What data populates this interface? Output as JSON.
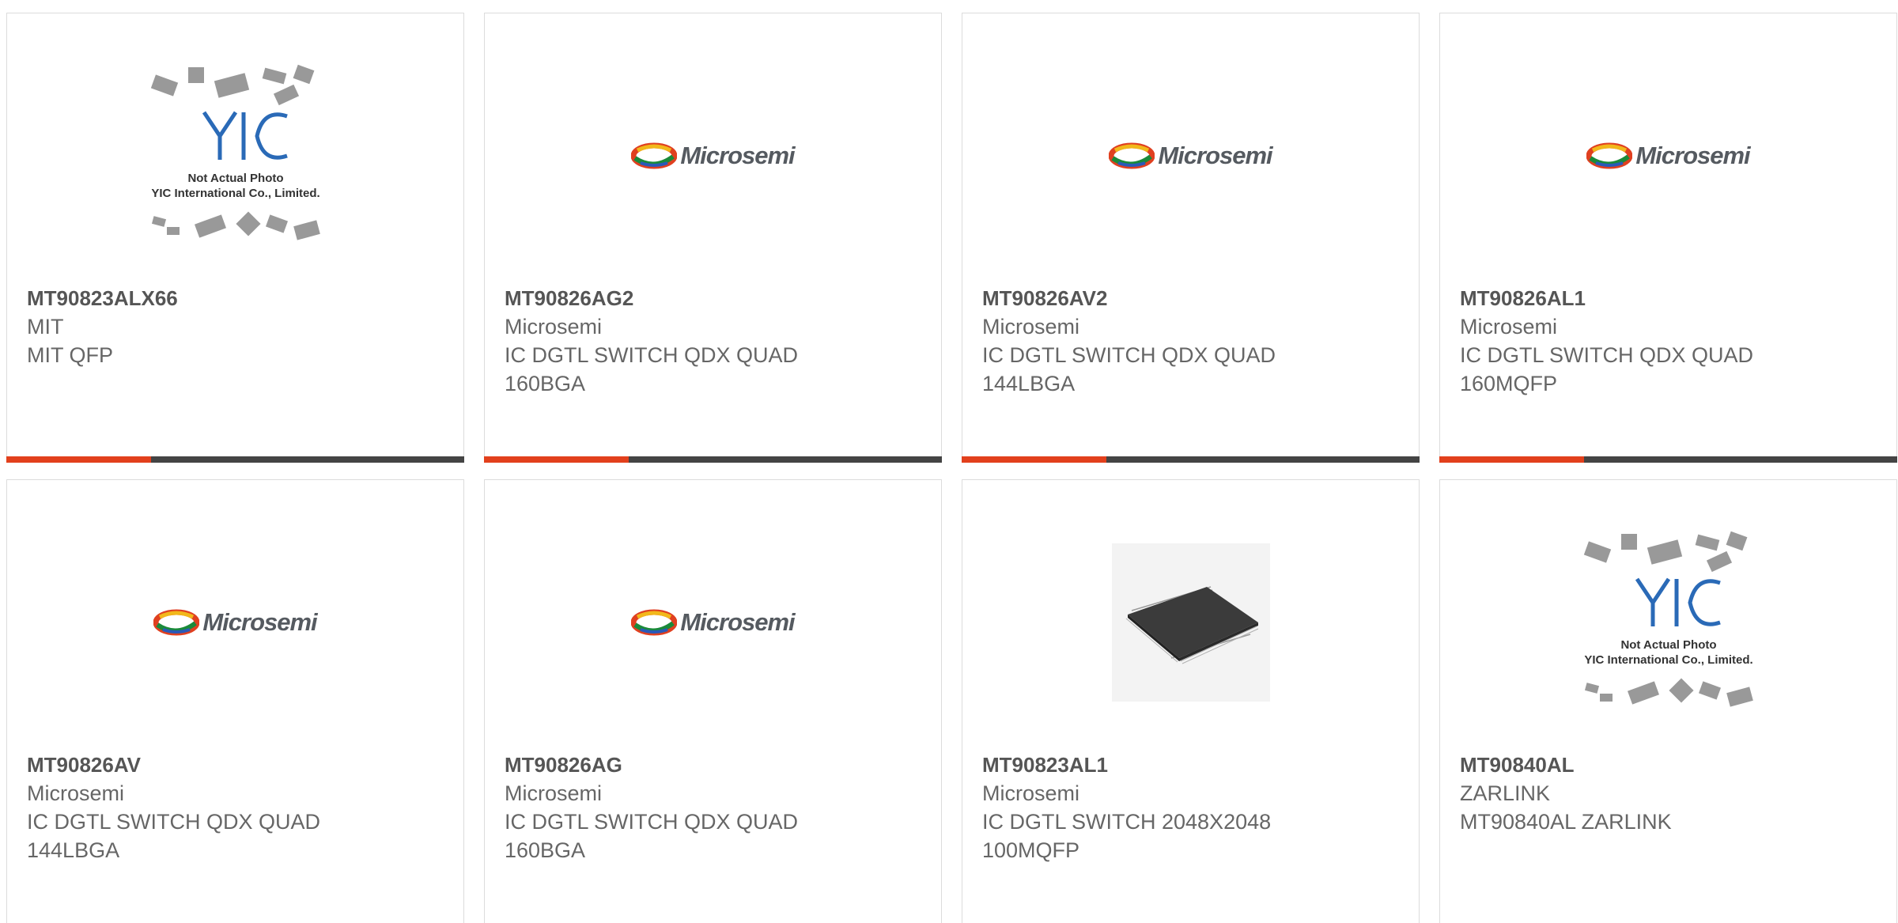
{
  "colors": {
    "accent": "#e2401c",
    "bar_dark": "#444444",
    "part_text": "#555555",
    "body_text": "#666666",
    "card_border": "#dcdcdc"
  },
  "products": [
    {
      "part": "MT90823ALX66",
      "brand": "MIT",
      "desc": "MIT QFP",
      "desc2": "",
      "image": "yic-placeholder",
      "placeholder_line1": "Not Actual Photo",
      "placeholder_line2": "YIC International Co., Limited."
    },
    {
      "part": "MT90826AG2",
      "brand": "Microsemi",
      "desc": "IC DGTL SWITCH QDX QUAD",
      "desc2": "160BGA",
      "image": "microsemi-logo",
      "logo_text": "Microsemi"
    },
    {
      "part": "MT90826AV2",
      "brand": "Microsemi",
      "desc": "IC DGTL SWITCH QDX QUAD",
      "desc2": "144LBGA",
      "image": "microsemi-logo",
      "logo_text": "Microsemi"
    },
    {
      "part": "MT90826AL1",
      "brand": "Microsemi",
      "desc": "IC DGTL SWITCH QDX QUAD",
      "desc2": "160MQFP",
      "image": "microsemi-logo",
      "logo_text": "Microsemi"
    },
    {
      "part": "MT90826AV",
      "brand": "Microsemi",
      "desc": "IC DGTL SWITCH QDX QUAD",
      "desc2": "144LBGA",
      "image": "microsemi-logo",
      "logo_text": "Microsemi"
    },
    {
      "part": "MT90826AG",
      "brand": "Microsemi",
      "desc": "IC DGTL SWITCH QDX QUAD",
      "desc2": "160BGA",
      "image": "microsemi-logo",
      "logo_text": "Microsemi"
    },
    {
      "part": "MT90823AL1",
      "brand": "Microsemi",
      "desc": "IC DGTL SWITCH 2048X2048",
      "desc2": "100MQFP",
      "image": "chip-photo"
    },
    {
      "part": "MT90840AL",
      "brand": "ZARLINK",
      "desc": "MT90840AL ZARLINK",
      "desc2": "",
      "image": "yic-placeholder",
      "placeholder_line1": "Not Actual Photo",
      "placeholder_line2": "YIC International Co., Limited."
    }
  ]
}
